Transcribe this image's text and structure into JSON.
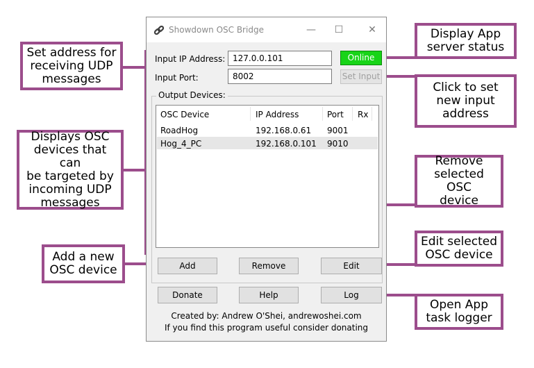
{
  "window": {
    "title": "Showdown OSC Bridge",
    "controls": {
      "minimize": "—",
      "maximize": "☐",
      "close": "✕"
    }
  },
  "form": {
    "ip_label": "Input IP Address:",
    "ip_value": "127.0.0.101",
    "port_label": "Input Port:",
    "port_value": "8002",
    "status_label": "Online",
    "set_input_label": "Set Input"
  },
  "devices": {
    "group_label": "Output Devices:",
    "columns": [
      "OSC Device",
      "IP Address",
      "Port",
      "Rx"
    ],
    "rows": [
      {
        "name": "RoadHog",
        "ip": "192.168.0.61",
        "port": "9001",
        "rx": ""
      },
      {
        "name": "Hog_4_PC",
        "ip": "192.168.0.101",
        "port": "9010",
        "rx": ""
      }
    ],
    "add_label": "Add",
    "remove_label": "Remove",
    "edit_label": "Edit"
  },
  "bottom": {
    "donate_label": "Donate",
    "help_label": "Help",
    "log_label": "Log"
  },
  "footer": {
    "line1": "Created by: Andrew O'Shei, andrewoshei.com",
    "line2": "If you find this program useful consider donating"
  },
  "callouts": {
    "set_address": "Set address for\nreceiving UDP\nmessages",
    "displays": "Displays OSC\ndevices that can\nbe targeted by\nincoming UDP\nmessages",
    "add_new": "Add a new\nOSC device",
    "display_status": "Display App\nserver status",
    "click_set": "Click to set\nnew input\naddress",
    "remove": "Remove\nselected OSC\ndevice",
    "edit": "Edit selected\nOSC device",
    "open_log": "Open App\ntask logger"
  },
  "colors": {
    "callout_border": "#9c4d8c",
    "online_green": "#18d418"
  }
}
